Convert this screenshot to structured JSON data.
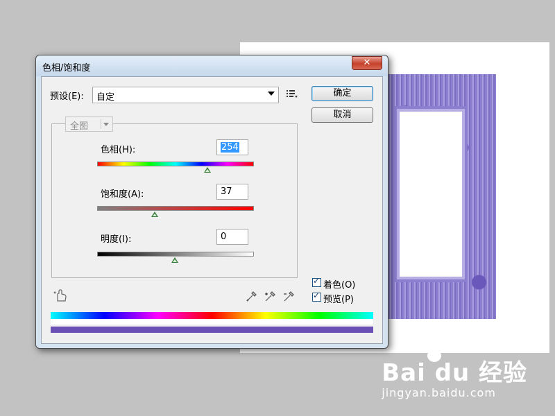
{
  "dialog": {
    "title": "色相/饱和度",
    "close_label": "✕",
    "preset_label": "预设(E):",
    "preset_value": "自定",
    "ok_label": "确定",
    "cancel_label": "取消",
    "channel_value": "全图",
    "hue": {
      "label": "色相(H):",
      "value": "254",
      "slider_fraction": 0.71
    },
    "saturation": {
      "label": "饱和度(A):",
      "value": "37",
      "slider_fraction": 0.37
    },
    "lightness": {
      "label": "明度(I):",
      "value": "0",
      "slider_fraction": 0.5
    },
    "colorize": {
      "label": "着色(O)",
      "checked": true
    },
    "preview": {
      "label": "预览(P)",
      "checked": true
    }
  },
  "watermark": {
    "logo": "Bai du 经验",
    "url": "jingyan.baidu.com"
  },
  "colors": {
    "frame_purple": "#8f82d0",
    "result_bar": "#6a50b4",
    "default_button_border": "#3c7fb1"
  },
  "icons": [
    "menu-list-icon",
    "hand-adjust-icon",
    "eyedropper-icon",
    "eyedropper-plus-icon",
    "eyedropper-minus-icon"
  ]
}
